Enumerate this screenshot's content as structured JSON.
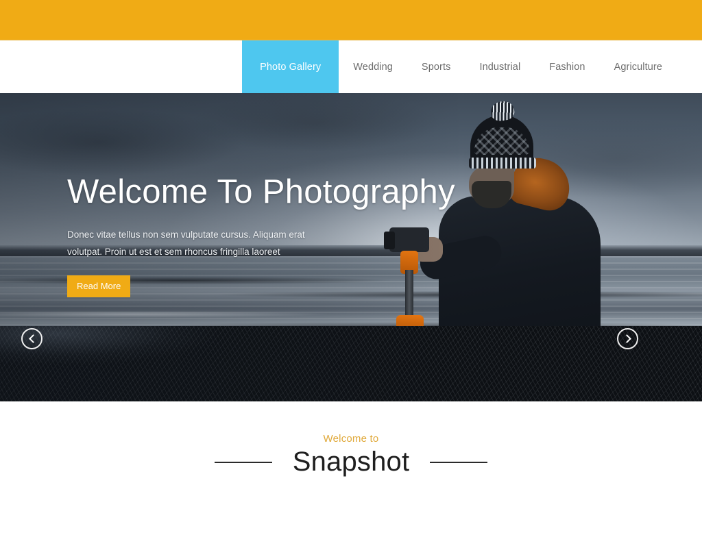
{
  "topbar": {
    "color": "#f0ab15"
  },
  "nav": {
    "active_color": "#4ec7ef",
    "items": [
      {
        "label": "Photo Gallery",
        "active": true
      },
      {
        "label": "Wedding",
        "active": false
      },
      {
        "label": "Sports",
        "active": false
      },
      {
        "label": "Industrial",
        "active": false
      },
      {
        "label": "Fashion",
        "active": false
      },
      {
        "label": "Agriculture",
        "active": false
      }
    ]
  },
  "hero": {
    "title": "Welcome To Photography",
    "description": "Donec vitae tellus non sem vulputate cursus. Aliquam erat volutpat. Proin ut est et sem rhoncus fringilla laoreet",
    "button_label": "Read More",
    "button_color": "#f0ab15",
    "prev_icon": "chevron-left-icon",
    "next_icon": "chevron-right-icon",
    "dots": [
      {
        "state": "gray",
        "color": "#b0b0b0"
      },
      {
        "state": "amber",
        "color": "#f0ab15"
      },
      {
        "state": "amber",
        "color": "#f0ab15"
      }
    ]
  },
  "welcome": {
    "kicker": "Welcome to",
    "kicker_color": "#e0a93a",
    "heading": "Snapshot"
  }
}
